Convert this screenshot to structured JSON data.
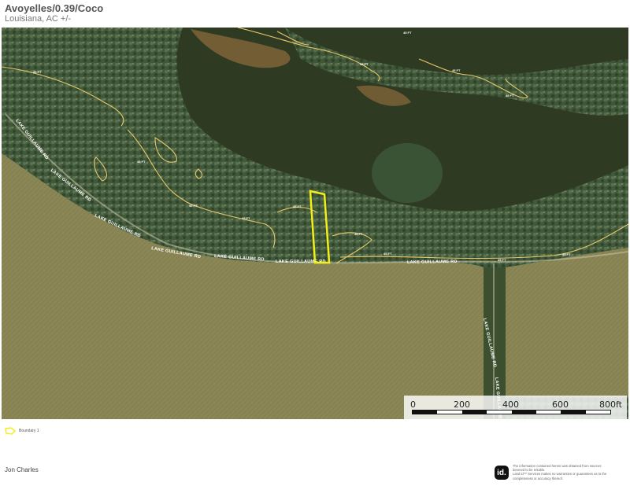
{
  "header": {
    "title": "Avoyelles/0.39/Coco",
    "subtitle": "Louisiana,  AC +/-"
  },
  "map": {
    "road_label": "LAKE GUILLAUME RD",
    "contour_label": "45 FT",
    "boundary_color": "#f2ef1a",
    "contour_color": "#e8c86a",
    "water_color": "#2f3a22",
    "field_color": "#8a8656",
    "forest_color": "#3f5a33"
  },
  "scalebar": {
    "labels": [
      "0",
      "200",
      "400",
      "600",
      "800ft"
    ]
  },
  "legend": {
    "items": [
      {
        "label": "Boundary 1",
        "icon": "boundary-polygon-icon",
        "color": "#f2ef1a"
      }
    ]
  },
  "footer": {
    "agent_name": "Jon Charles",
    "logo_text": "id.",
    "disclaimer_lines": [
      "The information contained herein was obtained from sources",
      "deemed to be reliable.",
      "Land id™ Services makes no warranties or guarantees as to the",
      "completeness or accuracy thereof."
    ]
  }
}
